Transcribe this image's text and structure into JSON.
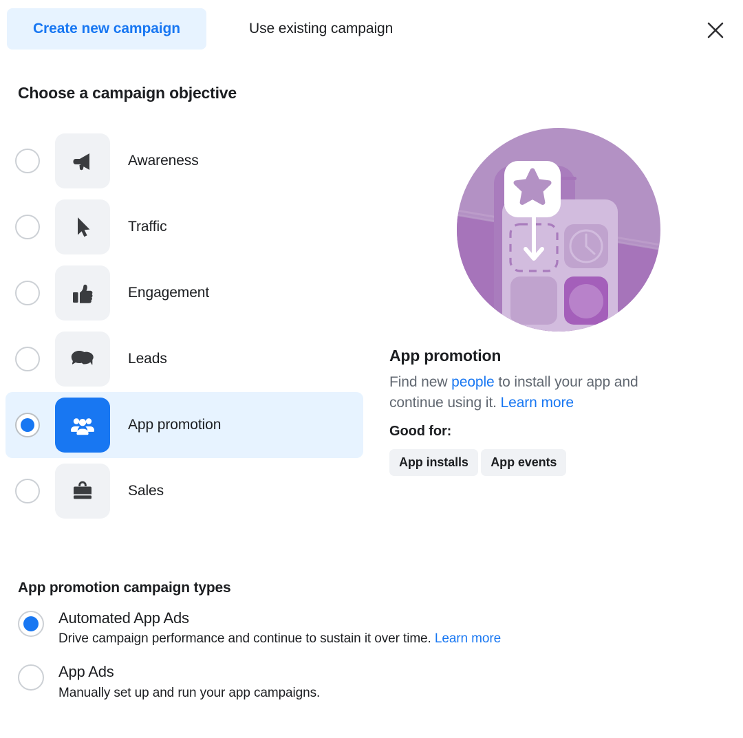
{
  "tabs": [
    {
      "label": "Create new campaign",
      "active": true,
      "name": "tab-create-new-campaign"
    },
    {
      "label": "Use existing campaign",
      "active": false,
      "name": "tab-use-existing-campaign"
    }
  ],
  "close_icon": "close-icon",
  "objective_section": {
    "heading": "Choose a campaign objective",
    "items": [
      {
        "label": "Awareness",
        "icon": "megaphone-icon",
        "selected": false
      },
      {
        "label": "Traffic",
        "icon": "cursor-arrow-icon",
        "selected": false
      },
      {
        "label": "Engagement",
        "icon": "thumbs-up-icon",
        "selected": false
      },
      {
        "label": "Leads",
        "icon": "chat-bubbles-icon",
        "selected": false
      },
      {
        "label": "App promotion",
        "icon": "people-group-icon",
        "selected": true
      },
      {
        "label": "Sales",
        "icon": "shopping-bag-icon",
        "selected": false
      }
    ]
  },
  "detail": {
    "illustration": "app-promotion-illustration",
    "title": "App promotion",
    "desc_part1": "Find new ",
    "desc_link1": "people",
    "desc_part2": " to install your app and continue using it. ",
    "desc_link2": "Learn more",
    "good_for_label": "Good for:",
    "badges": [
      "App installs",
      "App events"
    ]
  },
  "campaign_types": {
    "heading": "App promotion campaign types",
    "items": [
      {
        "title": "Automated App Ads",
        "desc": "Drive campaign performance and continue to sustain it over time. ",
        "link": "Learn more",
        "selected": true
      },
      {
        "title": "App Ads",
        "desc": "Manually set up and run your app campaigns.",
        "link": "",
        "selected": false
      }
    ]
  },
  "colors": {
    "accent_blue": "#1877f2",
    "accent_blue_bg": "#e7f3ff",
    "tile_gray": "#f0f2f5",
    "text_primary": "#1c1e21",
    "text_secondary": "#606770",
    "illustration_purple": "#b08ec0",
    "illustration_purple_dark": "#a06fb4"
  }
}
